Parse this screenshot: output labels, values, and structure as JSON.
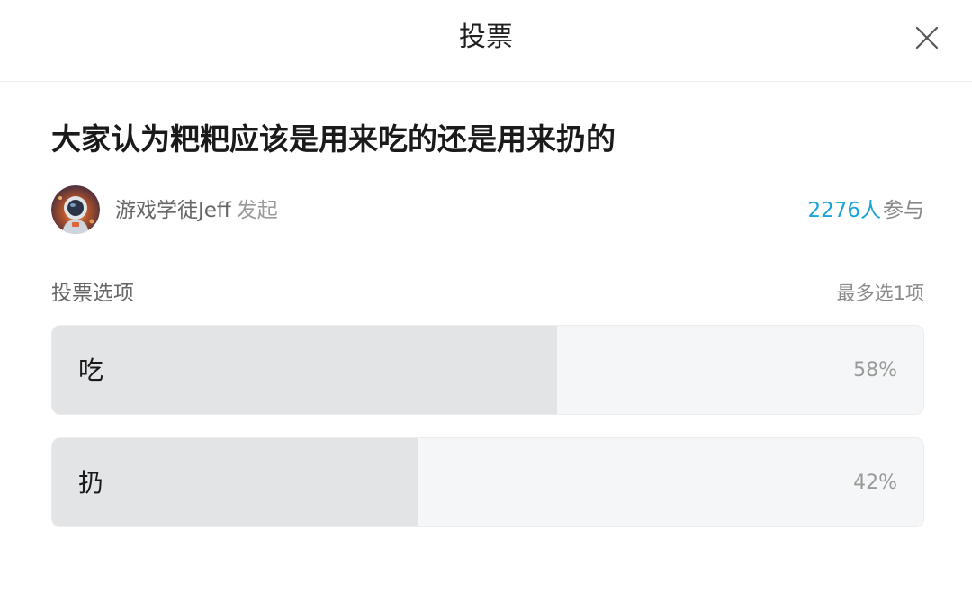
{
  "header": {
    "title": "投票",
    "close_icon": "close-icon"
  },
  "poll": {
    "question": "大家认为粑粑应该是用来吃的还是用来扔的",
    "author": {
      "name": "游戏学徒Jeff",
      "action": "发起",
      "avatar_icon": "avatar-astronaut"
    },
    "participants": {
      "count": "2276人",
      "suffix": "参与"
    },
    "options_title": "投票选项",
    "options_limit": "最多选1项",
    "options": [
      {
        "label": "吃",
        "percent_text": "58%",
        "fraction": 0.58
      },
      {
        "label": "扔",
        "percent_text": "42%",
        "fraction": 0.42
      }
    ]
  },
  "colors": {
    "accent": "#1aa3d9",
    "fill": "#e3e4e6",
    "track": "#f5f6f7"
  }
}
